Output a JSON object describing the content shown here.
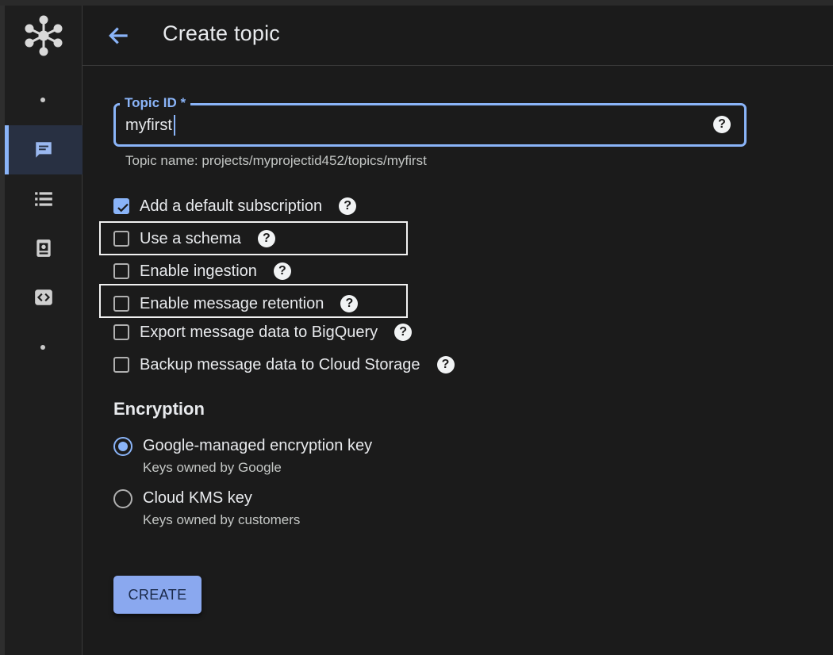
{
  "header": {
    "title": "Create topic"
  },
  "form": {
    "topic_id_label": "Topic ID *",
    "topic_id_value": "myfirst",
    "topic_name_hint": "Topic name: projects/myprojectid452/topics/myfirst",
    "options": [
      {
        "label": "Add a default subscription",
        "checked": true
      },
      {
        "label": "Use a schema",
        "checked": false
      },
      {
        "label": "Enable ingestion",
        "checked": false
      },
      {
        "label": "Enable message retention",
        "checked": false
      },
      {
        "label": "Export message data to BigQuery",
        "checked": false
      },
      {
        "label": "Backup message data to Cloud Storage",
        "checked": false
      }
    ],
    "help_glyph": "?"
  },
  "encryption": {
    "title": "Encryption",
    "options": [
      {
        "label": "Google-managed encryption key",
        "sublabel": "Keys owned by Google",
        "selected": true
      },
      {
        "label": "Cloud KMS key",
        "sublabel": "Keys owned by customers",
        "selected": false
      }
    ]
  },
  "actions": {
    "create_label": "CREATE"
  },
  "sidebar": {
    "items": [
      {
        "icon": "messages-icon",
        "active": true
      },
      {
        "icon": "list-icon",
        "active": false
      },
      {
        "icon": "snapshot-icon",
        "active": false
      },
      {
        "icon": "code-icon",
        "active": false
      }
    ]
  },
  "colors": {
    "accent": "#8ab4f8",
    "background": "#1b1b1b",
    "button": "#8aa8ef"
  }
}
